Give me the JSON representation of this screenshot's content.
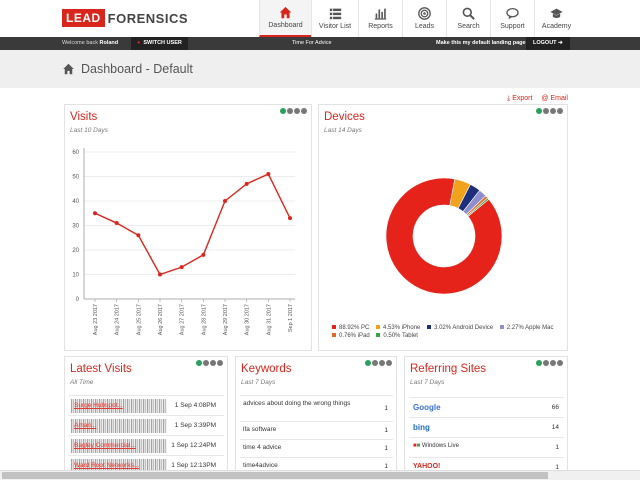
{
  "brand": {
    "lead": "LEAD",
    "forensics": "FORENSICS",
    "accent": "#d8261c"
  },
  "nav": [
    {
      "label": "Dashboard",
      "icon": "home-icon",
      "active": true
    },
    {
      "label": "Visitor List",
      "icon": "list-icon"
    },
    {
      "label": "Reports",
      "icon": "bar-chart-icon"
    },
    {
      "label": "Leads",
      "icon": "target-icon"
    },
    {
      "label": "Search",
      "icon": "search-icon"
    },
    {
      "label": "Support",
      "icon": "chat-icon"
    },
    {
      "label": "Academy",
      "icon": "graduation-cap-icon"
    }
  ],
  "userbar": {
    "welcome": "Welcome back",
    "user": "Roland",
    "switch_user": "SWITCH USER",
    "advice": "Time For Advice",
    "default_page": "Make this my default landing page",
    "logout": "LOGOUT"
  },
  "page": {
    "title": "Dashboard - Default",
    "export": "Export",
    "email": "Email"
  },
  "visits": {
    "title": "Visits",
    "subtitle": "Last 10 Days"
  },
  "devices": {
    "title": "Devices",
    "subtitle": "Last 14 Days"
  },
  "chart_data": [
    {
      "type": "line",
      "title": "Visits",
      "subtitle": "Last 10 Days",
      "categories": [
        "Aug 23 2017",
        "Aug 24 2017",
        "Aug 25 2017",
        "Aug 26 2017",
        "Aug 27 2017",
        "Aug 28 2017",
        "Aug 29 2017",
        "Aug 30 2017",
        "Aug 31 2017",
        "Sep 1 2017"
      ],
      "values": [
        35,
        31,
        26,
        10,
        13,
        18,
        40,
        47,
        51,
        33
      ],
      "ylim": [
        0,
        60
      ],
      "yticks": [
        0,
        10,
        20,
        30,
        40,
        50,
        60
      ],
      "color": "#d8261c",
      "grid": true
    },
    {
      "type": "pie",
      "title": "Devices",
      "subtitle": "Last 14 Days",
      "slices": [
        {
          "label": "PC",
          "value": 88.92,
          "text": "88.92% PC",
          "color": "#e5231b"
        },
        {
          "label": "iPhone",
          "value": 4.53,
          "text": "4.53% iPhone",
          "color": "#f0a21c"
        },
        {
          "label": "Android Device",
          "value": 3.02,
          "text": "3.02% Android Device",
          "color": "#1d2f7a"
        },
        {
          "label": "Apple Mac",
          "value": 2.27,
          "text": "2.27% Apple Mac",
          "color": "#8f8fd0"
        },
        {
          "label": "iPad",
          "value": 0.76,
          "text": "0.76% iPad",
          "color": "#e06a22"
        },
        {
          "label": "Tablet",
          "value": 0.5,
          "text": "0.50% Tablet",
          "color": "#3aa14a"
        }
      ]
    }
  ],
  "latest_visits": {
    "title": "Latest Visits",
    "subtitle": "All Time",
    "rows": [
      {
        "name": "Surge Hubspot...",
        "time": "1 Sep 4:08PM"
      },
      {
        "name": "Amari...",
        "time": "1 Sep 3:39PM"
      },
      {
        "name": "Bagley Commercial...",
        "time": "1 Sep 12:24PM"
      },
      {
        "name": "Ward Root Networks...",
        "time": "1 Sep 12:13PM"
      }
    ]
  },
  "keywords": {
    "title": "Keywords",
    "subtitle": "Last 7 Days",
    "rows": [
      {
        "text": "advices about doing the wrong things",
        "count": "1"
      },
      {
        "text": "lfa software",
        "count": "1"
      },
      {
        "text": "time 4 advice",
        "count": "1"
      },
      {
        "text": "time4advice",
        "count": "1"
      }
    ]
  },
  "referring": {
    "title": "Referring Sites",
    "subtitle": "Last 7 Days",
    "rows": [
      {
        "site": "Google",
        "count": "66"
      },
      {
        "site": "bing",
        "count": "14"
      },
      {
        "site": "Windows Live",
        "count": "1"
      },
      {
        "site": "YAHOO!",
        "count": "1"
      }
    ]
  }
}
